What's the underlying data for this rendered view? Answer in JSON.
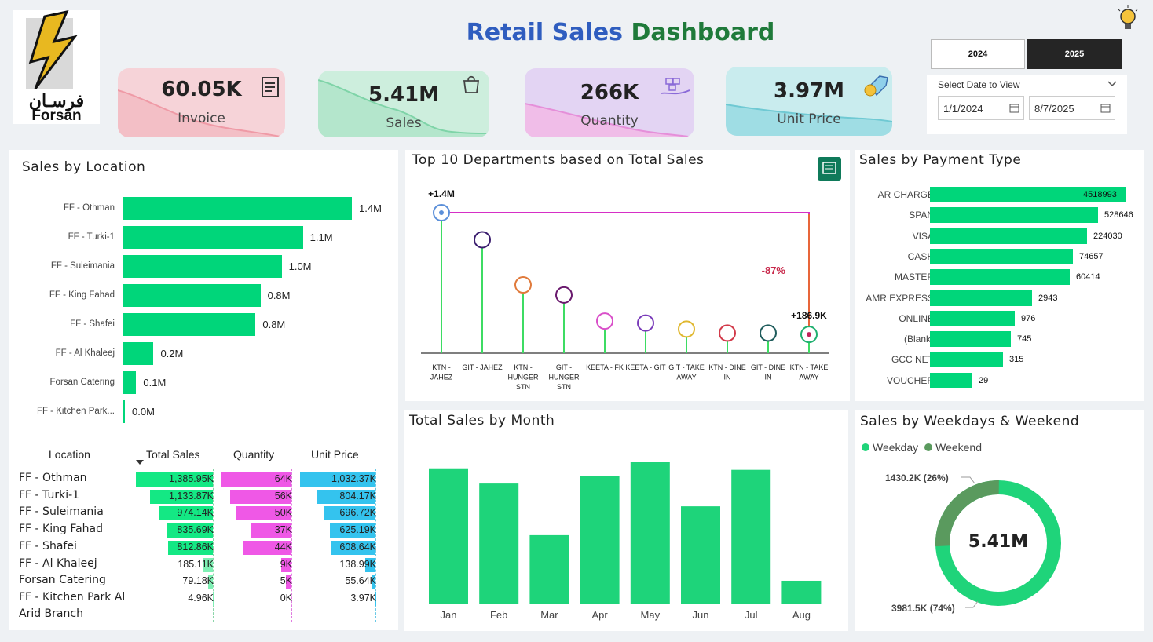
{
  "header": {
    "title_part1": "Retail Sales",
    "title_part2": "Dashboard",
    "logo_arabic": "فرسـان",
    "logo_text": "Forsan"
  },
  "kpis": [
    {
      "value": "60.05K",
      "label": "Invoice",
      "icon": "invoice-icon",
      "color": "#f6d3d8"
    },
    {
      "value": "5.41M",
      "label": "Sales",
      "icon": "shopping-bag-icon",
      "color": "#cdeedd"
    },
    {
      "value": "266K",
      "label": "Quantity",
      "icon": "boxes-hand-icon",
      "color": "#e3d4f3"
    },
    {
      "value": "3.97M",
      "label": "Unit Price",
      "icon": "price-tag-icon",
      "color": "#c9ecee"
    }
  ],
  "years": {
    "y2024": "2024",
    "y2025": "2025",
    "selected": "2025"
  },
  "date_filter": {
    "label": "Select Date to View",
    "start": "1/1/2024",
    "end": "8/7/2025"
  },
  "location": {
    "title": "Sales by Location",
    "items": [
      {
        "name": "FF - Othman",
        "label": "1.4M",
        "value": 1.4
      },
      {
        "name": "FF - Turki-1",
        "label": "1.1M",
        "value": 1.1
      },
      {
        "name": "FF - Suleimania",
        "label": "1.0M",
        "value": 0.97
      },
      {
        "name": "FF - King Fahad",
        "label": "0.8M",
        "value": 0.84
      },
      {
        "name": "FF - Shafei",
        "label": "0.8M",
        "value": 0.81
      },
      {
        "name": "FF - Al Khaleej",
        "label": "0.2M",
        "value": 0.185
      },
      {
        "name": "Forsan Catering",
        "label": "0.1M",
        "value": 0.079
      },
      {
        "name": "FF - Kitchen Park...",
        "label": "0.0M",
        "value": 0.005
      }
    ]
  },
  "table": {
    "headers": {
      "location": "Location",
      "sales": "Total Sales",
      "qty": "Quantity",
      "price": "Unit Price"
    },
    "rows": [
      {
        "loc": "FF - Othman",
        "sales": "1,385.95K",
        "qty": "64K",
        "price": "1,032.37K",
        "s": 1385.95,
        "q": 64,
        "p": 1032.37
      },
      {
        "loc": "FF - Turki-1",
        "sales": "1,133.87K",
        "qty": "56K",
        "price": "804.17K",
        "s": 1133.87,
        "q": 56,
        "p": 804.17
      },
      {
        "loc": "FF - Suleimania",
        "sales": "974.14K",
        "qty": "50K",
        "price": "696.72K",
        "s": 974.14,
        "q": 50,
        "p": 696.72
      },
      {
        "loc": "FF - King Fahad",
        "sales": "835.69K",
        "qty": "37K",
        "price": "625.19K",
        "s": 835.69,
        "q": 37,
        "p": 625.19
      },
      {
        "loc": "FF - Shafei",
        "sales": "812.86K",
        "qty": "44K",
        "price": "608.64K",
        "s": 812.86,
        "q": 44,
        "p": 608.64
      },
      {
        "loc": "FF - Al Khaleej",
        "sales": "185.11K",
        "qty": "9K",
        "price": "138.99K",
        "s": 185.11,
        "q": 9,
        "p": 138.99
      },
      {
        "loc": "Forsan Catering",
        "sales": "79.18K",
        "qty": "5K",
        "price": "55.64K",
        "s": 79.18,
        "q": 5,
        "p": 55.64
      },
      {
        "loc": "FF - Kitchen Park Al",
        "sales": "4.96K",
        "qty": "0K",
        "price": "3.97K",
        "s": 4.96,
        "q": 0,
        "p": 3.97
      }
    ],
    "wrap_line": "Arid Branch"
  },
  "departments": {
    "title": "Top 10 Departments based on Total Sales",
    "top_label": "+1.4M",
    "bottom_label": "+186.9K",
    "diff_label": "-87%",
    "items": [
      {
        "name": [
          "KTN -",
          "JAHEZ"
        ],
        "value": 1400,
        "color": "#5b8fd9"
      },
      {
        "name": [
          "GIT - JAHEZ"
        ],
        "value": 1130,
        "color": "#3a1d6e"
      },
      {
        "name": [
          "KTN -",
          "HUNGER",
          "STN"
        ],
        "value": 680,
        "color": "#e07a3b"
      },
      {
        "name": [
          "GIT -",
          "HUNGER",
          "STN"
        ],
        "value": 580,
        "color": "#6a1a6e"
      },
      {
        "name": [
          "KEETA - FK"
        ],
        "value": 320,
        "color": "#d94fc9"
      },
      {
        "name": [
          "KEETA - GIT"
        ],
        "value": 300,
        "color": "#7a3cba"
      },
      {
        "name": [
          "GIT - TAKE",
          "AWAY"
        ],
        "value": 240,
        "color": "#e0b830"
      },
      {
        "name": [
          "KTN - DINE",
          "IN"
        ],
        "value": 200,
        "color": "#d23a4a"
      },
      {
        "name": [
          "GIT - DINE",
          "IN"
        ],
        "value": 200,
        "color": "#1f5c5c"
      },
      {
        "name": [
          "KTN - TAKE",
          "AWAY"
        ],
        "value": 186.9,
        "color": "#20b070"
      }
    ]
  },
  "payment": {
    "title": "Sales by Payment Type",
    "items": [
      {
        "name": "AR CHARGE",
        "value": 4518993
      },
      {
        "name": "SPAN",
        "value": 528646
      },
      {
        "name": "VISA",
        "value": 224030
      },
      {
        "name": "CASH",
        "value": 74657
      },
      {
        "name": "MASTER",
        "value": 60414
      },
      {
        "name": "AMR EXPRESS",
        "value": 2943
      },
      {
        "name": "ONLINE",
        "value": 976
      },
      {
        "name": "(Blank)",
        "value": 745
      },
      {
        "name": "GCC NET",
        "value": 315
      },
      {
        "name": "VOUCHER",
        "value": 29
      }
    ]
  },
  "chart_data": {
    "type": "bar",
    "title": "Total Sales by Month",
    "categories": [
      "Jan",
      "Feb",
      "Mar",
      "Apr",
      "May",
      "Jun",
      "Jul",
      "Aug"
    ],
    "values": [
      890,
      790,
      450,
      840,
      930,
      640,
      880,
      150
    ],
    "xlabel": "",
    "ylabel": ""
  },
  "weekday": {
    "title": "Sales by Weekdays & Weekend",
    "legend_weekday": "Weekday",
    "legend_weekend": "Weekend",
    "center": "5.41M",
    "weekend_label": "1430.2K (26%)",
    "weekday_label": "3981.5K (74%)",
    "weekend_pct": 26,
    "weekday_color": "#1fd47a",
    "weekend_color": "#5a9a5e"
  }
}
